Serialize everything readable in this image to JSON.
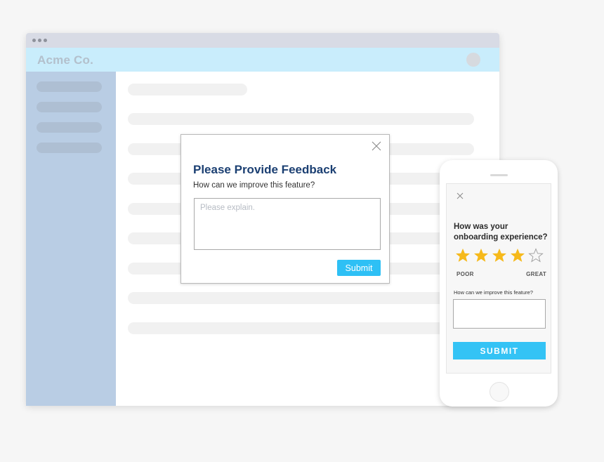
{
  "browser": {
    "brand": "Acme Co.",
    "sidebar_items": 4,
    "content_placeholder_rows": 9
  },
  "modal": {
    "title": "Please Provide Feedback",
    "subtitle": "How can we improve this feature?",
    "textarea_value": "",
    "textarea_placeholder": "Please explain.",
    "submit_label": "Submit"
  },
  "phone": {
    "question": "How was your onboarding experience?",
    "rating": {
      "value": 4,
      "max": 5
    },
    "rating_low_label": "POOR",
    "rating_high_label": "GREAT",
    "subtitle": "How can we improve this feature?",
    "textarea_value": "",
    "submit_label": "SUBMIT"
  },
  "colors": {
    "brand_title": "#1b3f72",
    "accent": "#2ec0f5",
    "star": "#f6b91b",
    "appbar": "#c9edfc",
    "sidebar": "#b9cde4"
  }
}
